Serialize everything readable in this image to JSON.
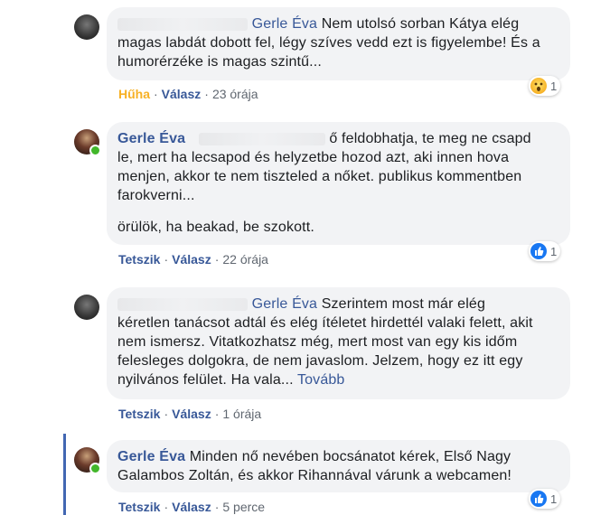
{
  "comments": [
    {
      "author": "",
      "tagged": "Gerle Éva",
      "text_line1": " Nem utolsó sorban Kátya elég",
      "text_rest": "magas labdát dobott fel, légy szíves vedd ezt is figyelembe! És a humorérzéke is magas szintű...",
      "action_reaction": "Hűha",
      "reply": "Válasz",
      "time": "23 órája",
      "reaction_count": "1",
      "reaction_icon": "wow-icon"
    },
    {
      "author": "Gerle Éva",
      "text_line1": "ő feldobhatja, te meg ne csapd",
      "text_rest": "le, mert ha lecsapod és helyzetbe hozod azt, aki innen hova menjen, akkor te nem tiszteled a nőket. publikus kommentben farokverni...",
      "text_para2": "örülök, ha beakad, be szokott.",
      "like": "Tetszik",
      "reply": "Válasz",
      "time": "22 órája",
      "reaction_count": "1",
      "reaction_icon": "like-icon"
    },
    {
      "author": "",
      "tagged": "Gerle Éva",
      "text_line1": " Szerintem most már elég",
      "text_rest": "kéretlen tanácsot adtál és elég ítéletet hirdettél valaki felett, akit nem ismersz. Vitatkozhatsz még, mert most van egy kis időm felesleges dolgokra, de nem javaslom. Jelzem, hogy ez itt egy nyilvános felület. Ha vala...",
      "more": "Tovább",
      "like": "Tetszik",
      "reply": "Válasz",
      "time": "1 órája"
    },
    {
      "author": "Gerle Éva",
      "text": "Minden nő nevében bocsánatot kérek, Első Nagy Galambos Zoltán, és akkor Rihannával várunk a webcamen!",
      "like": "Tetszik",
      "reply": "Válasz",
      "time": "5 perce",
      "reaction_count": "1",
      "reaction_icon": "like-icon"
    }
  ],
  "separator": "·",
  "colors": {
    "link": "#385898",
    "bubble": "#f2f3f5",
    "wow": "#f7b125",
    "like": "#1877f2",
    "online": "#42b72a",
    "thread": "#4267b2"
  }
}
